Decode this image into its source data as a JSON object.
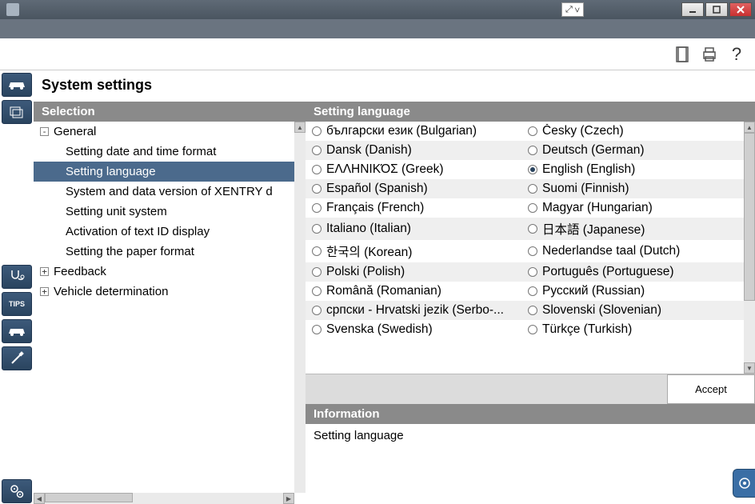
{
  "window": {
    "expand_label": "⤢ ∨"
  },
  "toolbar": {
    "help": "?"
  },
  "page": {
    "title": "System settings"
  },
  "selection": {
    "title": "Selection",
    "items": [
      {
        "label": "General",
        "expander": "⊟",
        "level": 0
      },
      {
        "label": "Setting date and time format",
        "level": 1
      },
      {
        "label": "Setting language",
        "level": 1,
        "selected": true
      },
      {
        "label": "System and data version of XENTRY d",
        "level": 1
      },
      {
        "label": "Setting unit system",
        "level": 1
      },
      {
        "label": "Activation of text ID display",
        "level": 1
      },
      {
        "label": "Setting the paper format",
        "level": 1
      },
      {
        "label": "Feedback",
        "expander": "⊞",
        "level": 0
      },
      {
        "label": "Vehicle determination",
        "expander": "⊞",
        "level": 0
      }
    ]
  },
  "languages": {
    "title": "Setting language",
    "selected": "English (English)",
    "rows": [
      {
        "left": "български език (Bulgarian)",
        "right": "Česky (Czech)"
      },
      {
        "left": "Dansk (Danish)",
        "right": "Deutsch (German)"
      },
      {
        "left": "ΕΛΛΗΝΙΚΌΣ (Greek)",
        "right": "English (English)"
      },
      {
        "left": "Español (Spanish)",
        "right": "Suomi (Finnish)"
      },
      {
        "left": "Français (French)",
        "right": "Magyar (Hungarian)"
      },
      {
        "left": "Italiano (Italian)",
        "right": "日本語 (Japanese)"
      },
      {
        "left": "한국의 (Korean)",
        "right": "Nederlandse taal (Dutch)"
      },
      {
        "left": "Polski (Polish)",
        "right": "Português (Portuguese)"
      },
      {
        "left": "Română (Romanian)",
        "right": "Русский (Russian)"
      },
      {
        "left": "српски - Hrvatski jezik (Serbo-...",
        "right": "Slovenski (Slovenian)"
      },
      {
        "left": "Svenska (Swedish)",
        "right": "Türkçe (Turkish)"
      }
    ],
    "accept": "Accept"
  },
  "info": {
    "title": "Information",
    "body": "Setting language"
  },
  "rail": {
    "tips": "TIPS"
  }
}
